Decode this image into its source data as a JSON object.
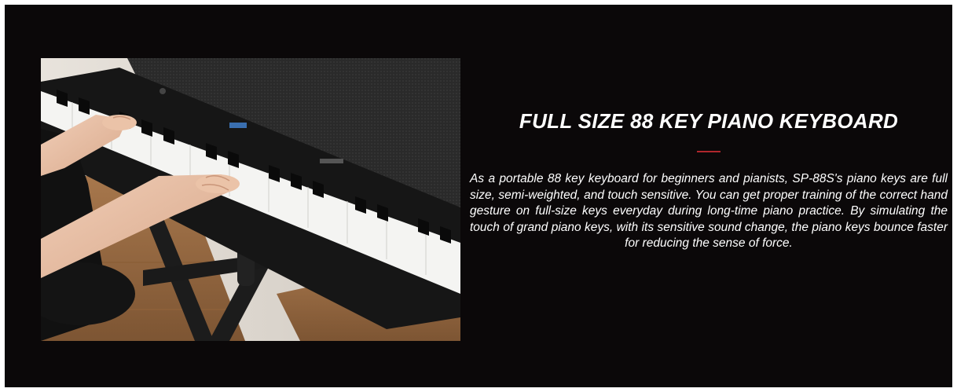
{
  "section": {
    "title": "FULL SIZE 88 KEY PIANO KEYBOARD",
    "description": "As a portable 88 key keyboard for beginners and pianists, SP-88S's piano keys are full size, semi-weighted, and touch sensitive. You can get proper training of the correct hand gesture on full-size keys everyday during long-time piano practice. By simulating the touch of grand piano keys, with its sensitive sound change, the piano keys bounce faster for reducing the sense of force."
  },
  "colors": {
    "background": "#0b0809",
    "accent": "#b0262c",
    "text": "#ffffff"
  },
  "image": {
    "subject": "hands playing digital piano keyboard on stand"
  }
}
